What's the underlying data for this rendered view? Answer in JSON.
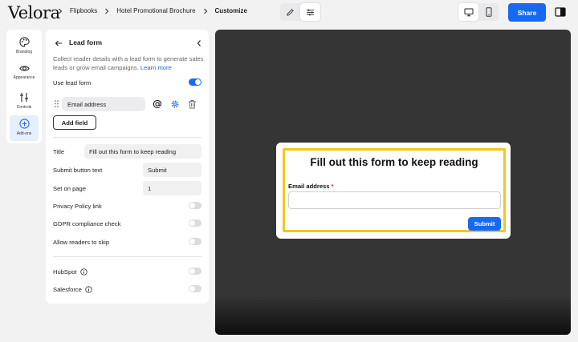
{
  "brand": {
    "logo": "Velora"
  },
  "breadcrumb": {
    "items": [
      "Flipbooks",
      "Hotel Promotional Brochure"
    ],
    "current": "Customize"
  },
  "toolbar": {
    "share_label": "Share"
  },
  "rail": {
    "items": [
      {
        "label": "Branding",
        "icon": "palette-icon"
      },
      {
        "label": "Appearance",
        "icon": "eye-icon"
      },
      {
        "label": "Controls",
        "icon": "sliders-icon"
      },
      {
        "label": "Add-ons",
        "icon": "plus-circle-icon"
      }
    ]
  },
  "panel": {
    "title": "Lead form",
    "description": "Collect reader details with a lead form to generate sales leads or grow email campaigns.",
    "learn_more": "Learn more",
    "use_lead_form": {
      "label": "Use lead form",
      "on": true
    },
    "field": {
      "label": "Email address"
    },
    "add_field_label": "Add field",
    "props": {
      "title": {
        "label": "Title",
        "value": "Fill out this form to keep reading"
      },
      "submit_text": {
        "label": "Submit button text",
        "value": "Submit"
      },
      "set_on_page": {
        "label": "Set on page",
        "value": "1"
      }
    },
    "toggles": {
      "privacy": {
        "label": "Privacy Policy link",
        "on": false
      },
      "gdpr": {
        "label": "GDPR compliance check",
        "on": false
      },
      "skip": {
        "label": "Allow readers to skip",
        "on": false
      }
    },
    "integrations": {
      "hubspot": {
        "label": "HubSpot",
        "on": false
      },
      "salesforce": {
        "label": "Salesforce",
        "on": false
      }
    }
  },
  "preview": {
    "title": "Fill out this form to keep reading",
    "field_label": "Email address",
    "required_mark": "*",
    "submit_label": "Submit"
  },
  "colors": {
    "accent": "#1769f0",
    "highlight": "#f2c623",
    "canvas": "#353535",
    "required": "#d9262d"
  }
}
